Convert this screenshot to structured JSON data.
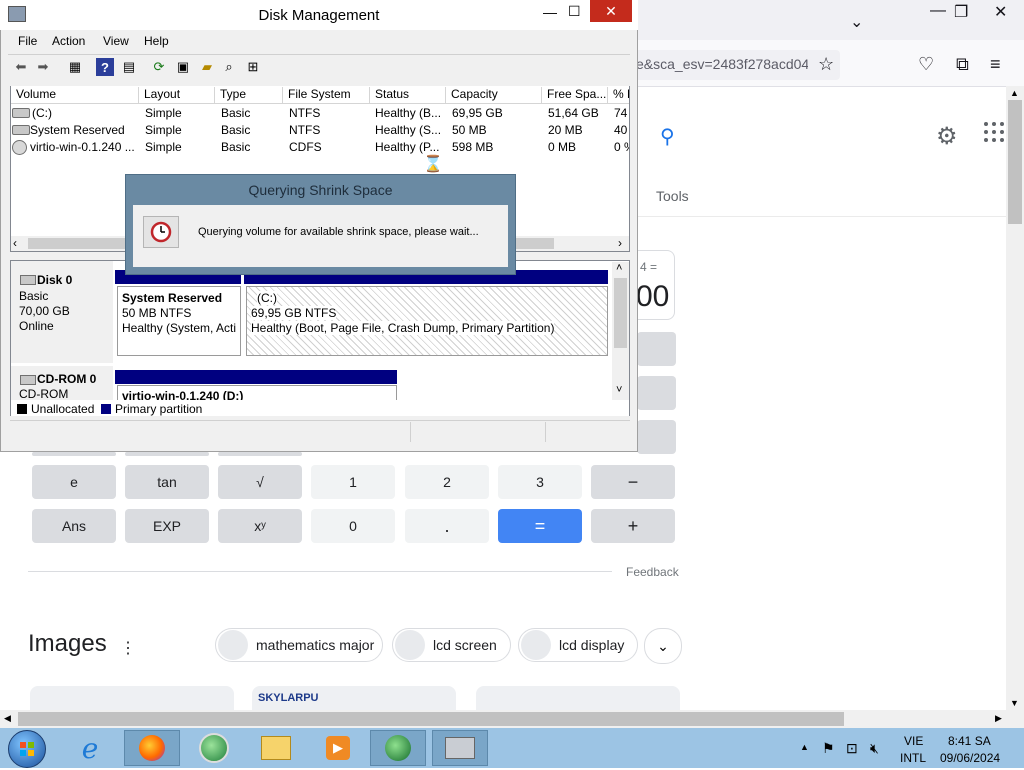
{
  "browser": {
    "url_fragment": "e&sca_esv=2483f278acd04",
    "tools_label": "Tools",
    "calc": {
      "display_small": "4 =",
      "display_big": "00",
      "keys": [
        {
          "label": "e"
        },
        {
          "label": "tan"
        },
        {
          "label": "√"
        },
        {
          "label": "1"
        },
        {
          "label": "2"
        },
        {
          "label": "3"
        },
        {
          "label": "−"
        },
        {
          "label": "Ans"
        },
        {
          "label": "EXP"
        },
        {
          "label": "xʸ"
        },
        {
          "label": "0"
        },
        {
          "label": "."
        },
        {
          "label": "="
        },
        {
          "label": "+"
        }
      ]
    },
    "feedback_label": "Feedback",
    "images_title": "Images",
    "chips": [
      {
        "label": "mathematics major"
      },
      {
        "label": "lcd screen"
      },
      {
        "label": "lcd display"
      }
    ],
    "image_card_text": "SKYLARPU"
  },
  "disk_mgmt": {
    "title": "Disk Management",
    "menu": [
      "File",
      "Action",
      "View",
      "Help"
    ],
    "columns": [
      "Volume",
      "Layout",
      "Type",
      "File System",
      "Status",
      "Capacity",
      "Free Spa...",
      "% F"
    ],
    "rows": [
      {
        "volume": "(C:)",
        "layout": "Simple",
        "type": "Basic",
        "fs": "NTFS",
        "status": "Healthy (B...",
        "capacity": "69,95 GB",
        "free": "51,64 GB",
        "pct": "74"
      },
      {
        "volume": "System Reserved",
        "layout": "Simple",
        "type": "Basic",
        "fs": "NTFS",
        "status": "Healthy (S...",
        "capacity": "50 MB",
        "free": "20 MB",
        "pct": "40"
      },
      {
        "volume": "virtio-win-0.1.240 ...",
        "layout": "Simple",
        "type": "Basic",
        "fs": "CDFS",
        "status": "Healthy (P...",
        "capacity": "598 MB",
        "free": "0 MB",
        "pct": "0 %"
      }
    ],
    "disk0": {
      "name": "Disk 0",
      "type": "Basic",
      "size": "70,00 GB",
      "state": "Online",
      "sysres": {
        "name": "System Reserved",
        "fs": "50 MB NTFS",
        "status": "Healthy (System, Acti"
      },
      "c": {
        "name": "(C:)",
        "fs": "69,95 GB NTFS",
        "status": "Healthy (Boot, Page File, Crash Dump, Primary Partition)"
      }
    },
    "cdrom0": {
      "name": "CD-ROM 0",
      "type": "CD-ROM",
      "volume": "virtio-win-0.1.240 (D:)"
    },
    "legend": {
      "unallocated": "Unallocated",
      "primary": "Primary partition"
    }
  },
  "dialog": {
    "title": "Querying Shrink Space",
    "message": "Querying volume for available shrink space, please wait..."
  },
  "taskbar": {
    "language": "VIE",
    "keyboard": "INTL",
    "time": "8:41 SA",
    "date": "09/06/2024"
  },
  "colors": {
    "primary_partition": "#000080",
    "dialog_frame": "#6a8aa3",
    "taskbar": "#9cc4e4",
    "close_button": "#c42b1c",
    "equals_key": "#4285f4"
  }
}
